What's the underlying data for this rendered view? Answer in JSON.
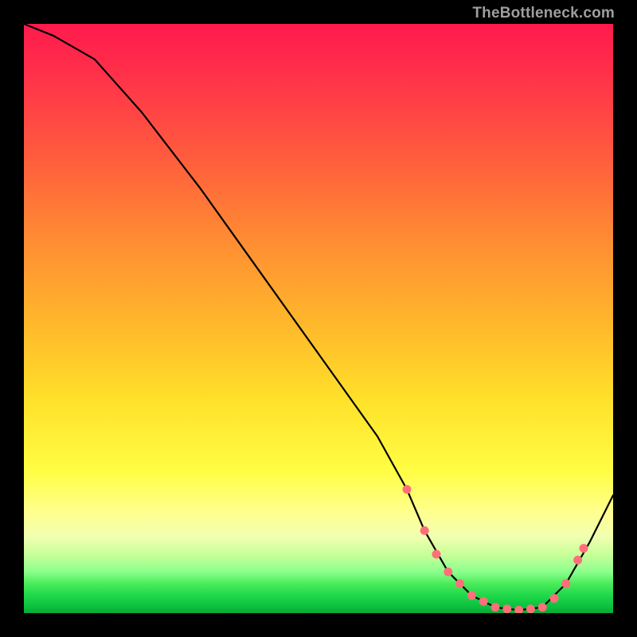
{
  "watermark": "TheBottleneck.com",
  "chart_data": {
    "type": "line",
    "title": "",
    "xlabel": "",
    "ylabel": "",
    "xlim": [
      0,
      100
    ],
    "ylim": [
      0,
      100
    ],
    "series": [
      {
        "name": "bottleneck-curve",
        "x": [
          0,
          5,
          12,
          20,
          30,
          40,
          50,
          60,
          65,
          68,
          72,
          76,
          80,
          84,
          88,
          92,
          96,
          100
        ],
        "y": [
          100,
          98,
          94,
          85,
          72,
          58,
          44,
          30,
          21,
          14,
          7,
          3,
          1,
          0.5,
          1,
          5,
          12,
          20
        ]
      }
    ],
    "markers": {
      "name": "highlighted-range",
      "color": "#ff6f7a",
      "x": [
        65,
        68,
        70,
        72,
        74,
        76,
        78,
        80,
        82,
        84,
        86,
        88,
        90,
        92,
        94,
        95
      ],
      "y": [
        21,
        14,
        10,
        7,
        5,
        3,
        2,
        1,
        0.7,
        0.5,
        0.7,
        1,
        2.5,
        5,
        9,
        11
      ]
    }
  }
}
